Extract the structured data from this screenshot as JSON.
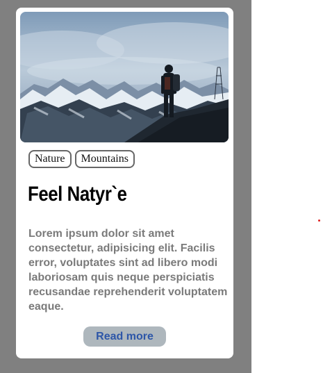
{
  "card": {
    "tags": [
      "Nature",
      "Mountains"
    ],
    "title": "Feel Natyr`e",
    "description": "Lorem ipsum dolor sit amet consectetur, adipisicing elit. Facilis error, voluptates sint ad libero modi laboriosam quis neque perspiciatis recusandae reprehenderit voluptatem eaque.",
    "button_label": "Read more"
  },
  "colors": {
    "stage_background": "#808080",
    "card_background": "#ffffff",
    "button_background": "#aeb7bd",
    "button_text": "#2d56a8",
    "description_text": "#7a7a7a",
    "accent_dot": "#e02020"
  }
}
